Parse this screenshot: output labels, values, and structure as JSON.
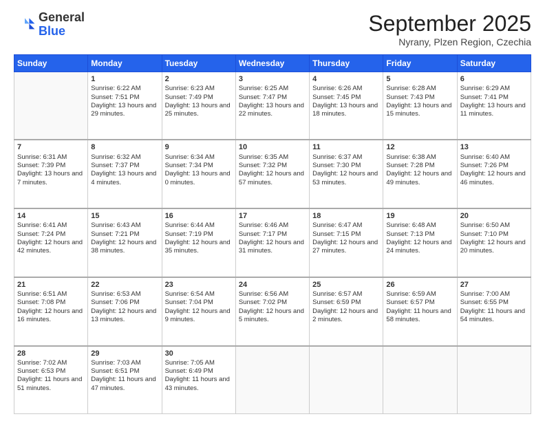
{
  "logo": {
    "general": "General",
    "blue": "Blue"
  },
  "header": {
    "month": "September 2025",
    "location": "Nyrany, Plzen Region, Czechia"
  },
  "weekdays": [
    "Sunday",
    "Monday",
    "Tuesday",
    "Wednesday",
    "Thursday",
    "Friday",
    "Saturday"
  ],
  "weeks": [
    [
      {
        "day": "",
        "sunrise": "",
        "sunset": "",
        "daylight": ""
      },
      {
        "day": "1",
        "sunrise": "Sunrise: 6:22 AM",
        "sunset": "Sunset: 7:51 PM",
        "daylight": "Daylight: 13 hours and 29 minutes."
      },
      {
        "day": "2",
        "sunrise": "Sunrise: 6:23 AM",
        "sunset": "Sunset: 7:49 PM",
        "daylight": "Daylight: 13 hours and 25 minutes."
      },
      {
        "day": "3",
        "sunrise": "Sunrise: 6:25 AM",
        "sunset": "Sunset: 7:47 PM",
        "daylight": "Daylight: 13 hours and 22 minutes."
      },
      {
        "day": "4",
        "sunrise": "Sunrise: 6:26 AM",
        "sunset": "Sunset: 7:45 PM",
        "daylight": "Daylight: 13 hours and 18 minutes."
      },
      {
        "day": "5",
        "sunrise": "Sunrise: 6:28 AM",
        "sunset": "Sunset: 7:43 PM",
        "daylight": "Daylight: 13 hours and 15 minutes."
      },
      {
        "day": "6",
        "sunrise": "Sunrise: 6:29 AM",
        "sunset": "Sunset: 7:41 PM",
        "daylight": "Daylight: 13 hours and 11 minutes."
      }
    ],
    [
      {
        "day": "7",
        "sunrise": "Sunrise: 6:31 AM",
        "sunset": "Sunset: 7:39 PM",
        "daylight": "Daylight: 13 hours and 7 minutes."
      },
      {
        "day": "8",
        "sunrise": "Sunrise: 6:32 AM",
        "sunset": "Sunset: 7:37 PM",
        "daylight": "Daylight: 13 hours and 4 minutes."
      },
      {
        "day": "9",
        "sunrise": "Sunrise: 6:34 AM",
        "sunset": "Sunset: 7:34 PM",
        "daylight": "Daylight: 13 hours and 0 minutes."
      },
      {
        "day": "10",
        "sunrise": "Sunrise: 6:35 AM",
        "sunset": "Sunset: 7:32 PM",
        "daylight": "Daylight: 12 hours and 57 minutes."
      },
      {
        "day": "11",
        "sunrise": "Sunrise: 6:37 AM",
        "sunset": "Sunset: 7:30 PM",
        "daylight": "Daylight: 12 hours and 53 minutes."
      },
      {
        "day": "12",
        "sunrise": "Sunrise: 6:38 AM",
        "sunset": "Sunset: 7:28 PM",
        "daylight": "Daylight: 12 hours and 49 minutes."
      },
      {
        "day": "13",
        "sunrise": "Sunrise: 6:40 AM",
        "sunset": "Sunset: 7:26 PM",
        "daylight": "Daylight: 12 hours and 46 minutes."
      }
    ],
    [
      {
        "day": "14",
        "sunrise": "Sunrise: 6:41 AM",
        "sunset": "Sunset: 7:24 PM",
        "daylight": "Daylight: 12 hours and 42 minutes."
      },
      {
        "day": "15",
        "sunrise": "Sunrise: 6:43 AM",
        "sunset": "Sunset: 7:21 PM",
        "daylight": "Daylight: 12 hours and 38 minutes."
      },
      {
        "day": "16",
        "sunrise": "Sunrise: 6:44 AM",
        "sunset": "Sunset: 7:19 PM",
        "daylight": "Daylight: 12 hours and 35 minutes."
      },
      {
        "day": "17",
        "sunrise": "Sunrise: 6:46 AM",
        "sunset": "Sunset: 7:17 PM",
        "daylight": "Daylight: 12 hours and 31 minutes."
      },
      {
        "day": "18",
        "sunrise": "Sunrise: 6:47 AM",
        "sunset": "Sunset: 7:15 PM",
        "daylight": "Daylight: 12 hours and 27 minutes."
      },
      {
        "day": "19",
        "sunrise": "Sunrise: 6:48 AM",
        "sunset": "Sunset: 7:13 PM",
        "daylight": "Daylight: 12 hours and 24 minutes."
      },
      {
        "day": "20",
        "sunrise": "Sunrise: 6:50 AM",
        "sunset": "Sunset: 7:10 PM",
        "daylight": "Daylight: 12 hours and 20 minutes."
      }
    ],
    [
      {
        "day": "21",
        "sunrise": "Sunrise: 6:51 AM",
        "sunset": "Sunset: 7:08 PM",
        "daylight": "Daylight: 12 hours and 16 minutes."
      },
      {
        "day": "22",
        "sunrise": "Sunrise: 6:53 AM",
        "sunset": "Sunset: 7:06 PM",
        "daylight": "Daylight: 12 hours and 13 minutes."
      },
      {
        "day": "23",
        "sunrise": "Sunrise: 6:54 AM",
        "sunset": "Sunset: 7:04 PM",
        "daylight": "Daylight: 12 hours and 9 minutes."
      },
      {
        "day": "24",
        "sunrise": "Sunrise: 6:56 AM",
        "sunset": "Sunset: 7:02 PM",
        "daylight": "Daylight: 12 hours and 5 minutes."
      },
      {
        "day": "25",
        "sunrise": "Sunrise: 6:57 AM",
        "sunset": "Sunset: 6:59 PM",
        "daylight": "Daylight: 12 hours and 2 minutes."
      },
      {
        "day": "26",
        "sunrise": "Sunrise: 6:59 AM",
        "sunset": "Sunset: 6:57 PM",
        "daylight": "Daylight: 11 hours and 58 minutes."
      },
      {
        "day": "27",
        "sunrise": "Sunrise: 7:00 AM",
        "sunset": "Sunset: 6:55 PM",
        "daylight": "Daylight: 11 hours and 54 minutes."
      }
    ],
    [
      {
        "day": "28",
        "sunrise": "Sunrise: 7:02 AM",
        "sunset": "Sunset: 6:53 PM",
        "daylight": "Daylight: 11 hours and 51 minutes."
      },
      {
        "day": "29",
        "sunrise": "Sunrise: 7:03 AM",
        "sunset": "Sunset: 6:51 PM",
        "daylight": "Daylight: 11 hours and 47 minutes."
      },
      {
        "day": "30",
        "sunrise": "Sunrise: 7:05 AM",
        "sunset": "Sunset: 6:49 PM",
        "daylight": "Daylight: 11 hours and 43 minutes."
      },
      {
        "day": "",
        "sunrise": "",
        "sunset": "",
        "daylight": ""
      },
      {
        "day": "",
        "sunrise": "",
        "sunset": "",
        "daylight": ""
      },
      {
        "day": "",
        "sunrise": "",
        "sunset": "",
        "daylight": ""
      },
      {
        "day": "",
        "sunrise": "",
        "sunset": "",
        "daylight": ""
      }
    ]
  ]
}
